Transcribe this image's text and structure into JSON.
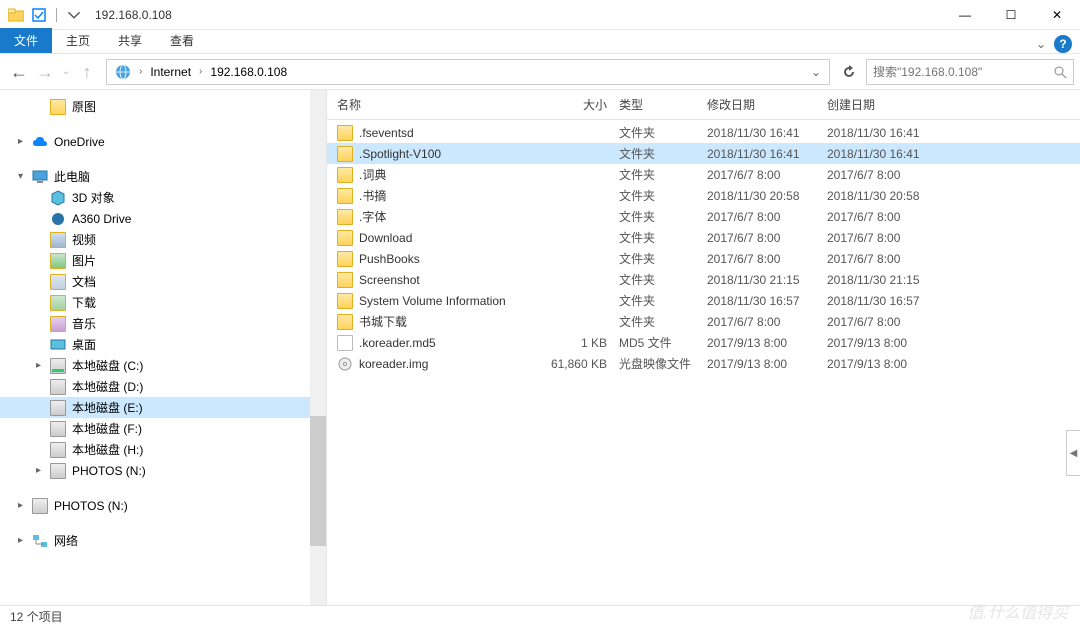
{
  "window": {
    "title": "192.168.0.108",
    "minimize": "—",
    "maximize": "☐",
    "close": "✕"
  },
  "ribbon": {
    "file": "文件",
    "home": "主页",
    "share": "共享",
    "view": "查看"
  },
  "breadcrumbs": {
    "internet": "Internet",
    "ip": "192.168.0.108"
  },
  "search": {
    "placeholder": "搜索\"192.168.0.108\""
  },
  "columns": {
    "name": "名称",
    "size": "大小",
    "type": "类型",
    "modified": "修改日期",
    "created": "创建日期"
  },
  "tree": [
    {
      "label": "原图",
      "icon": "folder",
      "chv": "",
      "lvl": 1
    },
    {
      "gap": true
    },
    {
      "label": "OneDrive",
      "icon": "cloud",
      "chv": "▸",
      "lvl": 0
    },
    {
      "gap": true
    },
    {
      "label": "此电脑",
      "icon": "monitor",
      "chv": "▾",
      "lvl": 0
    },
    {
      "label": "3D 对象",
      "icon": "3d",
      "chv": "",
      "lvl": 1
    },
    {
      "label": "A360 Drive",
      "icon": "a360",
      "chv": "",
      "lvl": 1
    },
    {
      "label": "视频",
      "icon": "video",
      "chv": "",
      "lvl": 1
    },
    {
      "label": "图片",
      "icon": "picture",
      "chv": "",
      "lvl": 1
    },
    {
      "label": "文档",
      "icon": "doc",
      "chv": "",
      "lvl": 1
    },
    {
      "label": "下载",
      "icon": "download",
      "chv": "",
      "lvl": 1
    },
    {
      "label": "音乐",
      "icon": "music",
      "chv": "",
      "lvl": 1
    },
    {
      "label": "桌面",
      "icon": "desktop",
      "chv": "",
      "lvl": 1
    },
    {
      "label": "本地磁盘 (C:)",
      "icon": "drive-c",
      "chv": "▸",
      "lvl": 1
    },
    {
      "label": "本地磁盘 (D:)",
      "icon": "drive",
      "chv": "",
      "lvl": 1
    },
    {
      "label": "本地磁盘 (E:)",
      "icon": "drive",
      "chv": "",
      "lvl": 1,
      "sel": true
    },
    {
      "label": "本地磁盘 (F:)",
      "icon": "drive",
      "chv": "",
      "lvl": 1
    },
    {
      "label": "本地磁盘 (H:)",
      "icon": "drive",
      "chv": "",
      "lvl": 1
    },
    {
      "label": "PHOTOS (N:)",
      "icon": "drive",
      "chv": "▸",
      "lvl": 1
    },
    {
      "gap": true
    },
    {
      "label": "PHOTOS (N:)",
      "icon": "drive",
      "chv": "▸",
      "lvl": 0
    },
    {
      "gap": true
    },
    {
      "label": "网络",
      "icon": "net",
      "chv": "▸",
      "lvl": 0
    }
  ],
  "files": [
    {
      "name": ".fseventsd",
      "size": "",
      "type": "文件夹",
      "mod": "2018/11/30 16:41",
      "cre": "2018/11/30 16:41",
      "icon": "folder"
    },
    {
      "name": ".Spotlight-V100",
      "size": "",
      "type": "文件夹",
      "mod": "2018/11/30 16:41",
      "cre": "2018/11/30 16:41",
      "icon": "folder",
      "sel": true
    },
    {
      "name": ".词典",
      "size": "",
      "type": "文件夹",
      "mod": "2017/6/7 8:00",
      "cre": "2017/6/7 8:00",
      "icon": "folder"
    },
    {
      "name": ".书摘",
      "size": "",
      "type": "文件夹",
      "mod": "2018/11/30 20:58",
      "cre": "2018/11/30 20:58",
      "icon": "folder"
    },
    {
      "name": ".字体",
      "size": "",
      "type": "文件夹",
      "mod": "2017/6/7 8:00",
      "cre": "2017/6/7 8:00",
      "icon": "folder"
    },
    {
      "name": "Download",
      "size": "",
      "type": "文件夹",
      "mod": "2017/6/7 8:00",
      "cre": "2017/6/7 8:00",
      "icon": "folder"
    },
    {
      "name": "PushBooks",
      "size": "",
      "type": "文件夹",
      "mod": "2017/6/7 8:00",
      "cre": "2017/6/7 8:00",
      "icon": "folder"
    },
    {
      "name": "Screenshot",
      "size": "",
      "type": "文件夹",
      "mod": "2018/11/30 21:15",
      "cre": "2018/11/30 21:15",
      "icon": "folder"
    },
    {
      "name": "System Volume Information",
      "size": "",
      "type": "文件夹",
      "mod": "2018/11/30 16:57",
      "cre": "2018/11/30 16:57",
      "icon": "folder"
    },
    {
      "name": "书城下载",
      "size": "",
      "type": "文件夹",
      "mod": "2017/6/7 8:00",
      "cre": "2017/6/7 8:00",
      "icon": "folder"
    },
    {
      "name": ".koreader.md5",
      "size": "1 KB",
      "type": "MD5 文件",
      "mod": "2017/9/13 8:00",
      "cre": "2017/9/13 8:00",
      "icon": "file"
    },
    {
      "name": "koreader.img",
      "size": "61,860 KB",
      "type": "光盘映像文件",
      "mod": "2017/9/13 8:00",
      "cre": "2017/9/13 8:00",
      "icon": "disc"
    }
  ],
  "status": "12 个项目",
  "watermark": "值.什么值得买"
}
